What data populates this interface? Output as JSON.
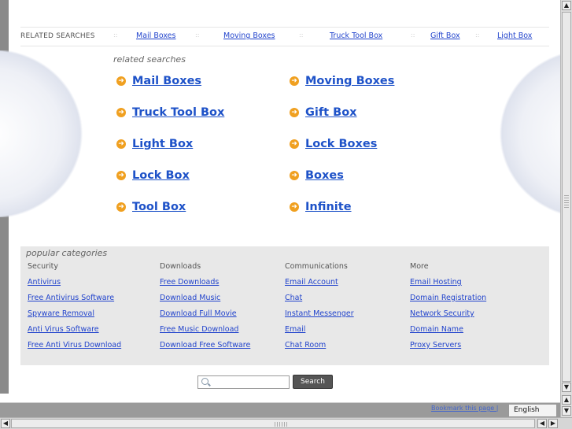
{
  "related_bar": {
    "label": "RELATED SEARCHES",
    "separator": "::",
    "links": [
      "Mail Boxes",
      "Moving Boxes",
      "Truck Tool Box",
      "Gift Box",
      "Light Box"
    ]
  },
  "related_searches": {
    "heading": "related searches",
    "items": [
      "Mail Boxes",
      "Moving Boxes",
      "Truck Tool Box",
      "Gift Box",
      "Light Box",
      "Lock Boxes",
      "Lock Box",
      "Boxes",
      "Tool Box",
      "Infinite"
    ]
  },
  "popular": {
    "title": "popular categories",
    "columns": [
      {
        "heading": "Security",
        "links": [
          "Antivirus",
          "Free Antivirus Software",
          "Spyware Removal",
          "Anti Virus Software",
          "Free Anti Virus Download"
        ]
      },
      {
        "heading": "Downloads",
        "links": [
          "Free Downloads",
          "Download Music",
          "Download Full Movie",
          "Free Music Download",
          "Download Free Software"
        ]
      },
      {
        "heading": "Communications",
        "links": [
          "Email Account",
          "Chat",
          "Instant Messenger",
          "Email",
          "Chat Room"
        ]
      },
      {
        "heading": "More",
        "links": [
          "Email Hosting",
          "Domain Registration",
          "Network Security",
          "Domain Name",
          "Proxy Servers"
        ]
      }
    ]
  },
  "search": {
    "value": "",
    "button_label": "Search"
  },
  "footer": {
    "bookmark": "Bookmark this page |",
    "language": "English"
  },
  "icons": {
    "list_arrow": "arrow-circle-right",
    "search": "magnifier"
  },
  "colors": {
    "link": "#1e52c8",
    "arrow": "#f0a020",
    "search_button": "#555555"
  }
}
